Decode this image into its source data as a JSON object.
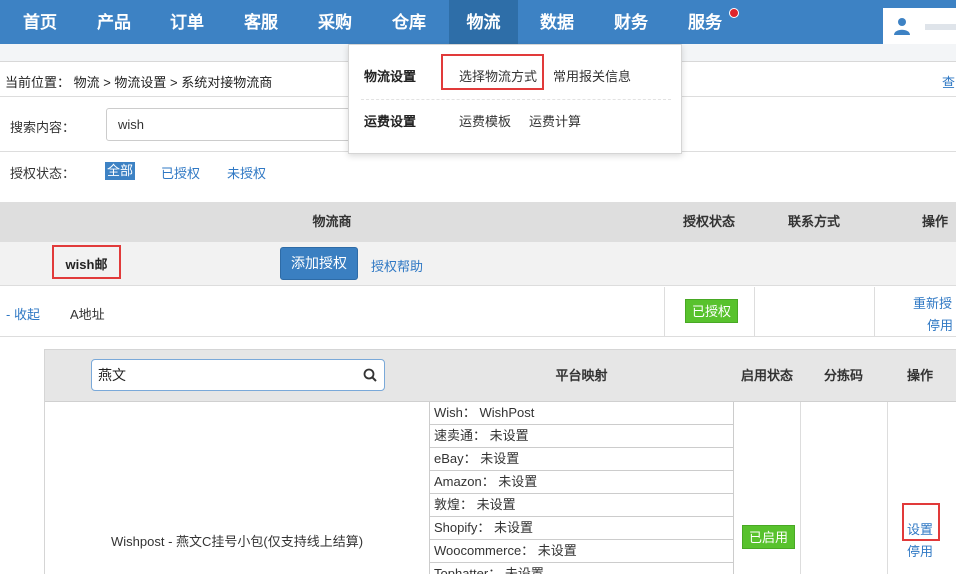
{
  "nav": {
    "items": [
      "首页",
      "产品",
      "订单",
      "客服",
      "采购",
      "仓库",
      "物流",
      "数据",
      "财务",
      "服务"
    ],
    "active_index": 6
  },
  "dropdown": {
    "groups": [
      {
        "title": "物流设置",
        "items": [
          "选择物流方式",
          "常用报关信息"
        ]
      },
      {
        "title": "运费设置",
        "items": [
          "运费模板",
          "运费计算"
        ]
      }
    ]
  },
  "breadcrumb": {
    "text": "当前位置： 物流 > 物流设置 > 系统对接物流商",
    "right_text": "查"
  },
  "search": {
    "label": "搜索内容：",
    "value": "wish"
  },
  "filter": {
    "label": "授权状态：",
    "options": [
      "全部",
      "已授权",
      "未授权"
    ],
    "active_index": 0
  },
  "table": {
    "headers": {
      "provider": "物流商",
      "status": "授权状态",
      "contact": "联系方式",
      "ops": "操作"
    },
    "group": {
      "name": "wish邮",
      "add_button": "添加授权",
      "help_link": "授权帮助"
    },
    "address_row": {
      "collapse": "- 收起",
      "address": "A地址",
      "status": "已授权",
      "ops": [
        "重新授",
        "停用"
      ]
    }
  },
  "nested": {
    "search_value": "燕文",
    "headers": {
      "mapping": "平台映射",
      "enabled": "启用状态",
      "sort_code": "分拣码",
      "ops": "操作"
    },
    "row": {
      "service": "Wishpost - 燕文C挂号小包(仅支持线上结算)",
      "mappings": [
        "Wish： WishPost",
        "速卖通： 未设置",
        "eBay： 未设置",
        "Amazon： 未设置",
        "敦煌： 未设置",
        "Shopify： 未设置",
        "Woocommerce： 未设置",
        "Tophatter： 未设置"
      ],
      "enabled": "已启用",
      "ops": [
        "设置",
        "停用"
      ]
    }
  },
  "colors": {
    "nav_bg": "#3d82c4",
    "link": "#2f78c4",
    "highlight": "#e13a3a",
    "badge_green": "#58c22d"
  }
}
